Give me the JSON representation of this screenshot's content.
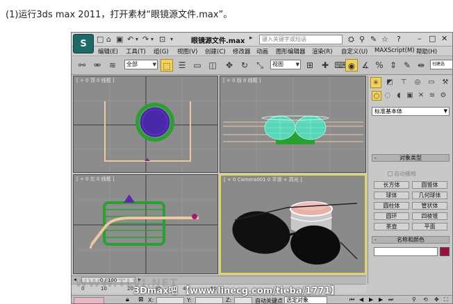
{
  "caption": "(1)运行3ds max 2011，打开素材“眼镜源文件.max”。",
  "app": {
    "logo": "S",
    "title": "眼镜源文件.max",
    "search_placeholder": "键入关键字或短语",
    "menus": [
      "编辑(E)",
      "工具(T)",
      "组(G)",
      "视图(V)",
      "创建(C)",
      "修改器",
      "动画",
      "图形编辑器",
      "渲染(R)",
      "自定义(U)",
      "MAXScript(M)",
      "帮助(H)"
    ],
    "toolbar": {
      "selection_filter": "全部",
      "ref_coord": "视图",
      "named_sel_hint": "创建选"
    },
    "viewports": {
      "top": "[ + 0 顶 0 线框 ]",
      "front": "[ + 0 前 0 线框 ]",
      "left": "[ + 0 左 0 线框 ]",
      "camera": "[ + 0 Camera001 0 平滑 + 高光 ]"
    },
    "command_panel": {
      "category": "标准基本体",
      "object_type_title": "对象类型",
      "autogrid": "自动栅格",
      "buttons": [
        "长方体",
        "圆锥体",
        "球体",
        "几何球体",
        "圆柱体",
        "管状体",
        "圆环",
        "四棱锥",
        "茶壶",
        "平面"
      ],
      "name_color_title": "名称和颜色",
      "rollout_sign": "-"
    },
    "timeline": {
      "frame": "0 / 100",
      "ticks": [
        "0",
        "10",
        "20",
        "30",
        "40",
        "50"
      ]
    },
    "statusbar": {
      "x_label": "X:",
      "y_label": "Y:",
      "z_label": "Z:",
      "autokey": "自动关键点",
      "selected": "选定对象"
    },
    "accent_color": "#f4d25a"
  },
  "watermark": "3Dmax吧 【www.linecg.com/tieba/1771】",
  "watermark_bg": "WWW.TLVI.NET"
}
